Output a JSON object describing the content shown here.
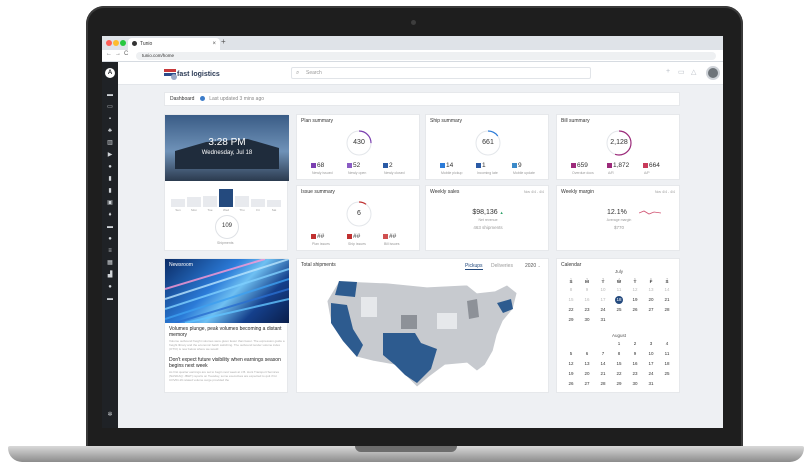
{
  "browser": {
    "tab_title": "Tunio",
    "url": "tunio.com/home"
  },
  "app": {
    "user_initial": "A",
    "logo_text": "fast logistics",
    "search_placeholder": "Search"
  },
  "breadcrumb": {
    "title": "Dashboard",
    "updated": "Last updated 3 mins ago"
  },
  "hero": {
    "time": "3:28 PM",
    "date": "Wednesday, Jul 18"
  },
  "week_chart": {
    "days": [
      "Sun",
      "Mon",
      "Tue",
      "Wed",
      "Thu",
      "Fri",
      "Sat"
    ],
    "values": [
      0.45,
      0.55,
      0.6,
      1.0,
      0.6,
      0.45,
      0.4
    ],
    "selected": 3,
    "total": "109",
    "total_label": "Shipments"
  },
  "plan": {
    "title": "Plan summary",
    "total": "430",
    "fraction": 0.25,
    "stats": [
      {
        "value": "68",
        "label": "Newly issued",
        "color": "#7b3fb0"
      },
      {
        "value": "52",
        "label": "Newly open",
        "color": "#8a5cc4"
      },
      {
        "value": "2",
        "label": "Newly closed",
        "color": "#2a5aa5"
      }
    ]
  },
  "ship": {
    "title": "Ship summary",
    "total": "661",
    "fraction": 0.15,
    "stats": [
      {
        "value": "14",
        "label": "Mobile pickup",
        "color": "#2b7bd8"
      },
      {
        "value": "1",
        "label": "Incoming late",
        "color": "#2a5aa5"
      },
      {
        "value": "9",
        "label": "Mobile update",
        "color": "#3b8ac9"
      }
    ]
  },
  "bill": {
    "title": "Bill summary",
    "total": "2,128",
    "fraction": 0.55,
    "stats": [
      {
        "value": "659",
        "label": "Overdue docs",
        "color": "#9c2a7a"
      },
      {
        "value": "1,872",
        "label": "A/R",
        "color": "#9c2a7a"
      },
      {
        "value": "664",
        "label": "A/P",
        "color": "#c83a5a"
      }
    ]
  },
  "issue": {
    "title": "Issue summary",
    "total": "6",
    "fraction": 0.1,
    "stats": [
      {
        "value": "##",
        "label": "Plan issues",
        "color": "#c03030"
      },
      {
        "value": "##",
        "label": "Ship issues",
        "color": "#c03030"
      },
      {
        "value": "##",
        "label": "Bill issues",
        "color": "#d05050"
      }
    ]
  },
  "weekly_sales": {
    "title": "Weekly sales",
    "range": "Nov 4/4 - 4/4",
    "amount": "$98,136",
    "amount_sub": "Net revenue",
    "shipments": "463 shipments"
  },
  "weekly_margin": {
    "title": "Weekly margin",
    "range": "Nov 4/4 - 4/4",
    "percent": "12.1%",
    "percent_sub": "Average margin",
    "amount": "$770"
  },
  "news": {
    "tag": "Newsroom",
    "h1": "Volumes plunge, peak volumes becoming a distant memory",
    "p1": "Volume outbound freight volumes were given fewer than fewer. The expression guide a freight library and the economic batch switching. The outbound tender volume index (OTVI) is now below where we would",
    "h2": "Don't expect future visibility when earnings season begins next week",
    "p2": "As first quarter earnings are set to begin next week at J.B. Hunt Transport Services (NASDAQ: JBHT) reports on Tuesday, some executives are expected to quit if for COVID-19 related volume surge provided the"
  },
  "shipments": {
    "title": "Total shipments",
    "tab1": "Pickups",
    "tab2": "Deliveries",
    "year": "2020"
  },
  "calendar": {
    "title": "Calendar",
    "weekdays": [
      "S",
      "M",
      "T",
      "W",
      "T",
      "F",
      "S"
    ],
    "july": {
      "name": "July",
      "rows": [
        [
          "1",
          "2",
          "3",
          "4",
          "5",
          "6",
          "7"
        ],
        [
          "8",
          "9",
          "10",
          "11",
          "12",
          "13",
          "14"
        ],
        [
          "15",
          "16",
          "17",
          "18",
          "19",
          "20",
          "21"
        ],
        [
          "22",
          "23",
          "24",
          "25",
          "26",
          "27",
          "28"
        ],
        [
          "29",
          "30",
          "31",
          "",
          "",
          "",
          ""
        ]
      ],
      "today": "18"
    },
    "august": {
      "name": "August",
      "rows": [
        [
          "",
          "",
          "",
          "1",
          "2",
          "3",
          "4"
        ],
        [
          "5",
          "6",
          "7",
          "8",
          "9",
          "10",
          "11"
        ],
        [
          "12",
          "13",
          "14",
          "15",
          "16",
          "17",
          "18"
        ],
        [
          "19",
          "20",
          "21",
          "22",
          "23",
          "24",
          "25"
        ],
        [
          "26",
          "27",
          "28",
          "29",
          "30",
          "31",
          ""
        ]
      ]
    }
  }
}
